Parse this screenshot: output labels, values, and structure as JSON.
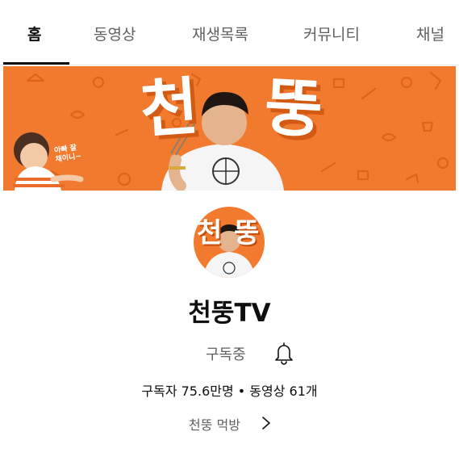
{
  "tabs": [
    {
      "label": "홈",
      "active": true
    },
    {
      "label": "동영상",
      "active": false
    },
    {
      "label": "재생목록",
      "active": false
    },
    {
      "label": "커뮤니티",
      "active": false
    },
    {
      "label": "채널",
      "active": false
    }
  ],
  "banner": {
    "title_left": "천",
    "title_right": "뚱",
    "speech_line1": "아빠 잘",
    "speech_line2": "채이니~",
    "background_color": "#f27a2e"
  },
  "avatar": {
    "text_left": "천",
    "text_right": "뚱"
  },
  "channel": {
    "name": "천뚱TV",
    "subscribe_status": "구독중",
    "stats": "구독자 75.6만명 • 동영상 61개",
    "description": "천뚱 먹방"
  },
  "icons": {
    "notification": "bell-icon",
    "more": "chevron-right-icon"
  }
}
